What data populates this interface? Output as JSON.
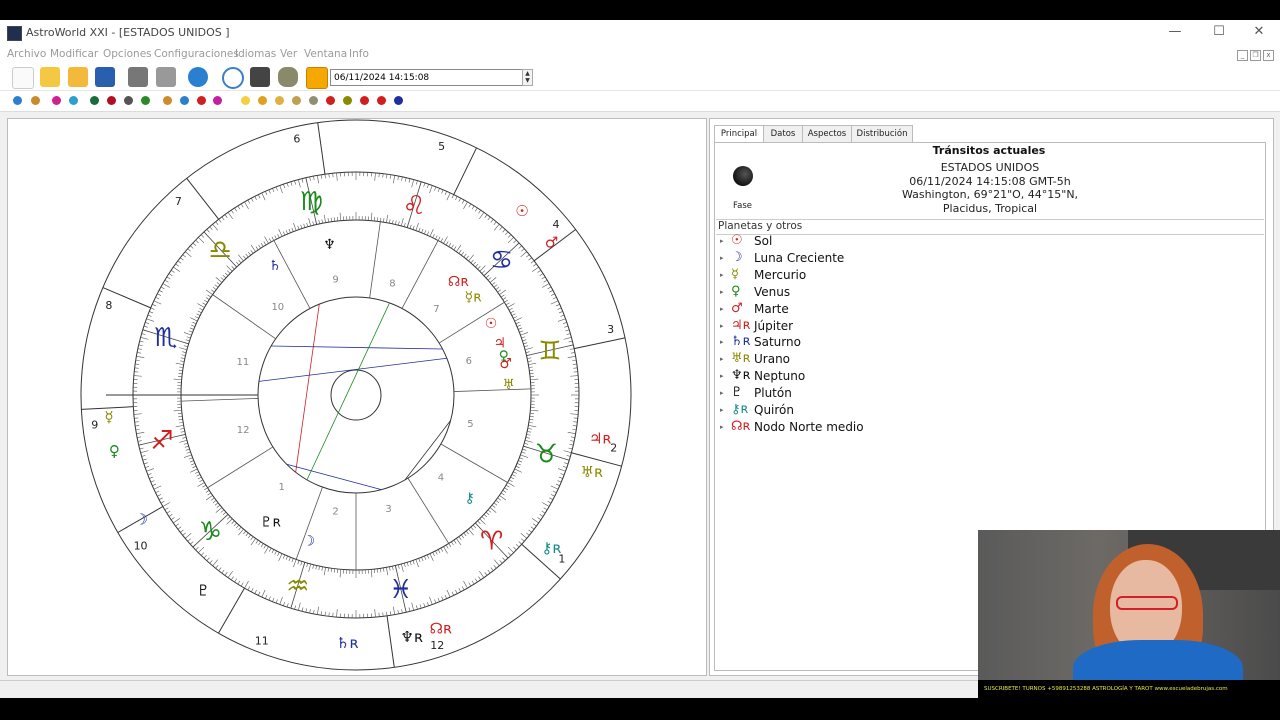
{
  "window": {
    "title": "AstroWorld XXI  - [ESTADOS UNIDOS ]",
    "minimize": "—",
    "maximize": "☐",
    "close": "✕"
  },
  "menu": [
    "Archivo",
    "Modificar",
    "Opciones",
    "Configuraciones",
    "Idiomas",
    "Ver",
    "Ventana",
    "Info"
  ],
  "toolbar": {
    "datetime_value": "06/11/2024 14:15:08"
  },
  "tabs": [
    "Principal",
    "Datos",
    "Aspectos",
    "Distribución"
  ],
  "info": {
    "title": "Tránsitos actuales",
    "name": "ESTADOS UNIDOS",
    "datetime": "06/11/2024 14:15:08 GMT-5h",
    "location": "Washington, 69°21\"O, 44°15\"N,",
    "system": "Placidus, Tropical",
    "phase_label": "Fase"
  },
  "planets_header": "Planetas y otros",
  "planets": [
    {
      "glyph": "☉",
      "name": "Sol",
      "color": "#d11f1f"
    },
    {
      "glyph": "☽",
      "name": "Luna Creciente",
      "color": "#1f2f9f"
    },
    {
      "glyph": "☿",
      "name": "Mercurio",
      "color": "#8a8a00"
    },
    {
      "glyph": "♀",
      "name": "Venus",
      "color": "#1a8a1a"
    },
    {
      "glyph": "♂",
      "name": "Marte",
      "color": "#d11f1f"
    },
    {
      "glyph": "♃ʀ",
      "name": "Júpiter",
      "color": "#d11f1f"
    },
    {
      "glyph": "♄ʀ",
      "name": "Saturno",
      "color": "#1f2f9f"
    },
    {
      "glyph": "♅ʀ",
      "name": "Urano",
      "color": "#8a8a00"
    },
    {
      "glyph": "♆ʀ",
      "name": "Neptuno",
      "color": "#111111"
    },
    {
      "glyph": "♇",
      "name": "Plutón",
      "color": "#111111"
    },
    {
      "glyph": "⚷ʀ",
      "name": "Quirón",
      "color": "#138a8a"
    },
    {
      "glyph": "☊ʀ",
      "name": "Nodo Norte medio",
      "color": "#d11f1f"
    }
  ],
  "chart": {
    "outer_house_numbers": [
      "6",
      "7",
      "8",
      "9",
      "10",
      "11",
      "12",
      "1",
      "2",
      "3",
      "4",
      "5"
    ],
    "inner_house_numbers": [
      "9",
      "10",
      "11",
      "12",
      "1",
      "2",
      "3",
      "4",
      "5",
      "6",
      "7",
      "8"
    ],
    "signs": [
      {
        "glyph": "♍",
        "color": "#1a8a1a"
      },
      {
        "glyph": "♎",
        "color": "#8a8a00"
      },
      {
        "glyph": "♏",
        "color": "#1f2f9f"
      },
      {
        "glyph": "♐",
        "color": "#d11f1f"
      },
      {
        "glyph": "♑",
        "color": "#1a8a1a"
      },
      {
        "glyph": "♒",
        "color": "#8a8a00"
      },
      {
        "glyph": "♓",
        "color": "#1f2f9f"
      },
      {
        "glyph": "♈",
        "color": "#d11f1f"
      },
      {
        "glyph": "♉",
        "color": "#1a8a1a"
      },
      {
        "glyph": "♊",
        "color": "#8a8a00"
      },
      {
        "glyph": "♋",
        "color": "#1f2f9f"
      },
      {
        "glyph": "♌",
        "color": "#d11f1f"
      }
    ],
    "outer_planets": [
      {
        "glyph": "♂",
        "color": "#d11f1f"
      },
      {
        "glyph": "☉",
        "color": "#d11f1f"
      },
      {
        "glyph": "☿",
        "color": "#8a8a00"
      },
      {
        "glyph": "♀",
        "color": "#1a8a1a"
      },
      {
        "glyph": "☽",
        "color": "#1f2f9f"
      },
      {
        "glyph": "♇",
        "color": "#111111"
      },
      {
        "glyph": "♄ʀ",
        "color": "#1f2f9f"
      },
      {
        "glyph": "♆ʀ",
        "color": "#111111"
      },
      {
        "glyph": "☊ʀ",
        "color": "#d11f1f"
      },
      {
        "glyph": "⚷ʀ",
        "color": "#138a8a"
      },
      {
        "glyph": "♅ʀ",
        "color": "#8a8a00"
      },
      {
        "glyph": "♃ʀ",
        "color": "#d11f1f"
      }
    ],
    "inner_planets": [
      {
        "glyph": "♆",
        "color": "#111111"
      },
      {
        "glyph": "♄",
        "color": "#1f2f9f"
      },
      {
        "glyph": "☊ʀ",
        "color": "#d11f1f"
      },
      {
        "glyph": "☿ʀ",
        "color": "#8a8a00"
      },
      {
        "glyph": "☉",
        "color": "#d11f1f"
      },
      {
        "glyph": "♃",
        "color": "#d11f1f"
      },
      {
        "glyph": "♀",
        "color": "#1a8a1a"
      },
      {
        "glyph": "♂",
        "color": "#d11f1f"
      },
      {
        "glyph": "♅",
        "color": "#8a8a00"
      },
      {
        "glyph": "⚷",
        "color": "#138a8a"
      },
      {
        "glyph": "☽",
        "color": "#1f2f9f"
      },
      {
        "glyph": "♇ʀ",
        "color": "#111111"
      }
    ]
  },
  "webcam_caption": "SUSCRIBETE! TURNOS +59891253288 ASTROLOGÍA Y TAROT   www.escueladebrujas.com"
}
